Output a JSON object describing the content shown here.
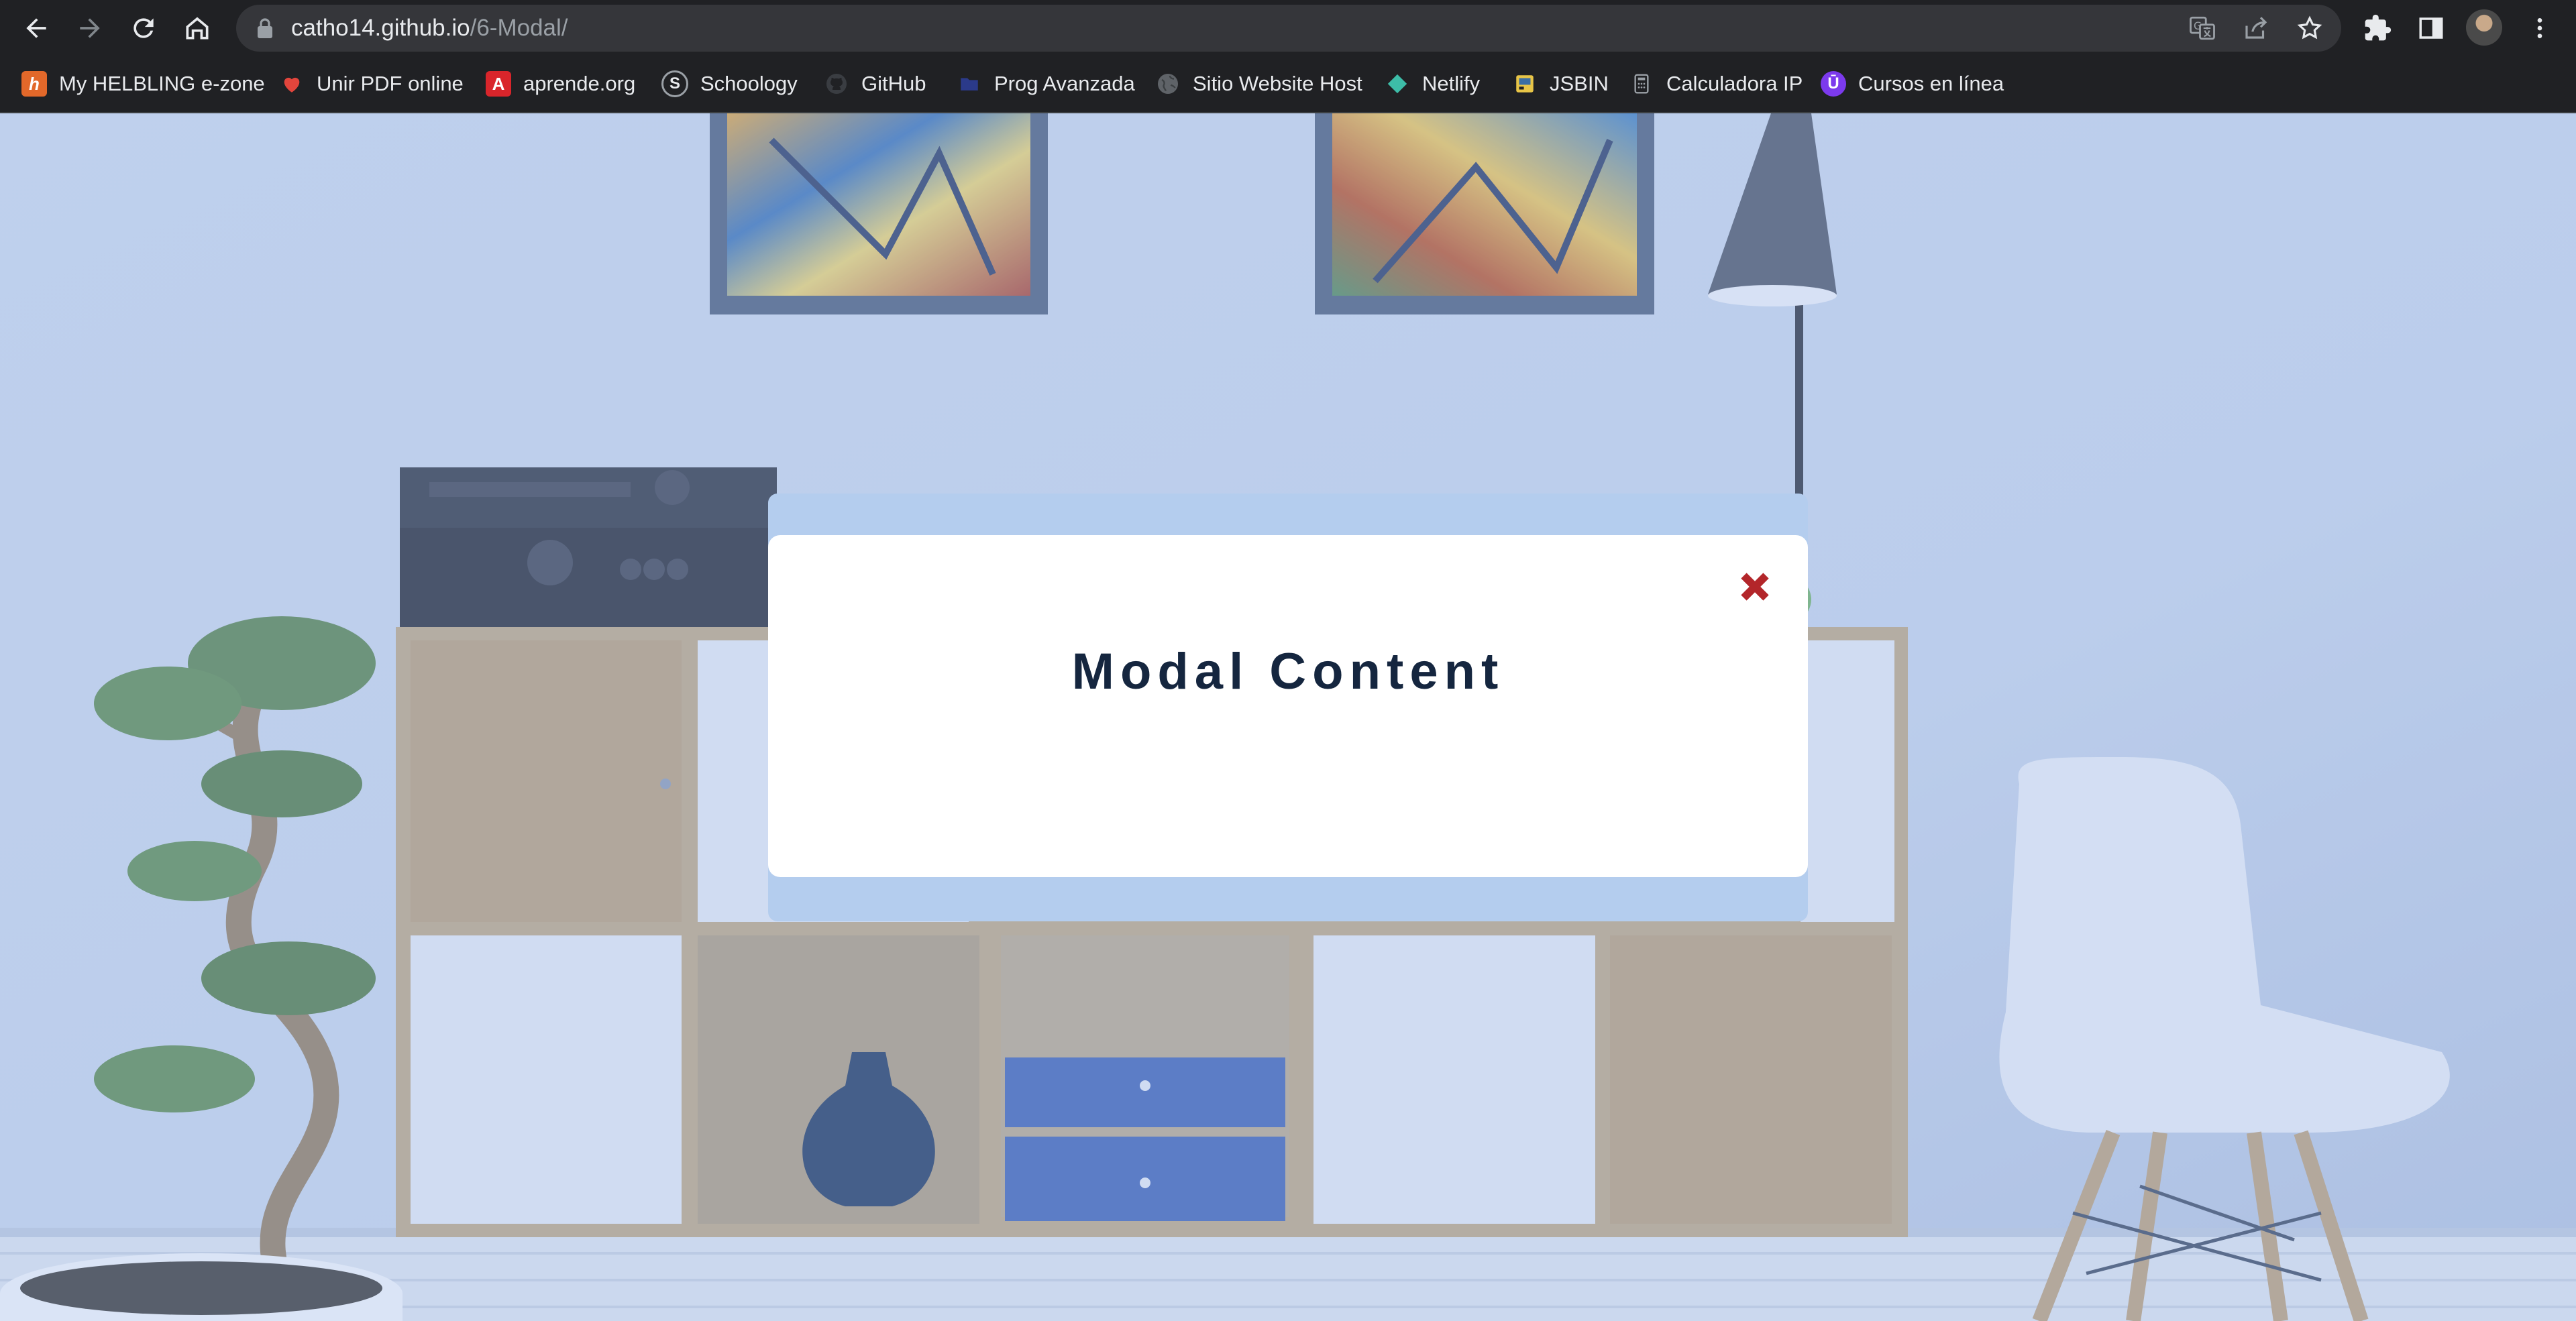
{
  "browser": {
    "url_host": "catho14.github.io",
    "url_path": "/6-Modal/",
    "icons": [
      "back-arrow-icon",
      "forward-arrow-icon",
      "reload-icon",
      "home-icon",
      "lock-icon",
      "translate-icon",
      "share-icon",
      "star-icon",
      "extensions-icon",
      "side-panel-icon",
      "avatar",
      "kebab-menu-icon"
    ]
  },
  "bookmarks": [
    {
      "label": "My HELBLING e-zone",
      "icon": "h",
      "color": "#e2682a"
    },
    {
      "label": "Unir PDF online",
      "icon": "heart",
      "color": "#e2453c"
    },
    {
      "label": "aprende.org",
      "icon": "A",
      "color": "#d9252b"
    },
    {
      "label": "Schoology",
      "icon": "S",
      "color": "#3a3d42"
    },
    {
      "label": "GitHub",
      "icon": "octocat",
      "color": "#3a3d42"
    },
    {
      "label": "Prog Avanzada",
      "icon": "folder",
      "color": "#2b3a8a"
    },
    {
      "label": "Sitio Website Host",
      "icon": "globe",
      "color": "#5f6368"
    },
    {
      "label": "Netlify",
      "icon": "diamond",
      "color": "#3dbda8"
    },
    {
      "label": "JSBIN",
      "icon": "jsbin",
      "color": "#e8c547"
    },
    {
      "label": "Calculadora IP",
      "icon": "calculator",
      "color": "#9aa0a6"
    },
    {
      "label": "Cursos en línea",
      "icon": "U",
      "color": "#7c3aed"
    }
  ],
  "modal": {
    "title": "Modal Content",
    "close_color": "#b3262a"
  },
  "colors": {
    "text_dark": "#15263f",
    "modal_frame": "#b4cdee",
    "overlay": "#aac3f0"
  }
}
